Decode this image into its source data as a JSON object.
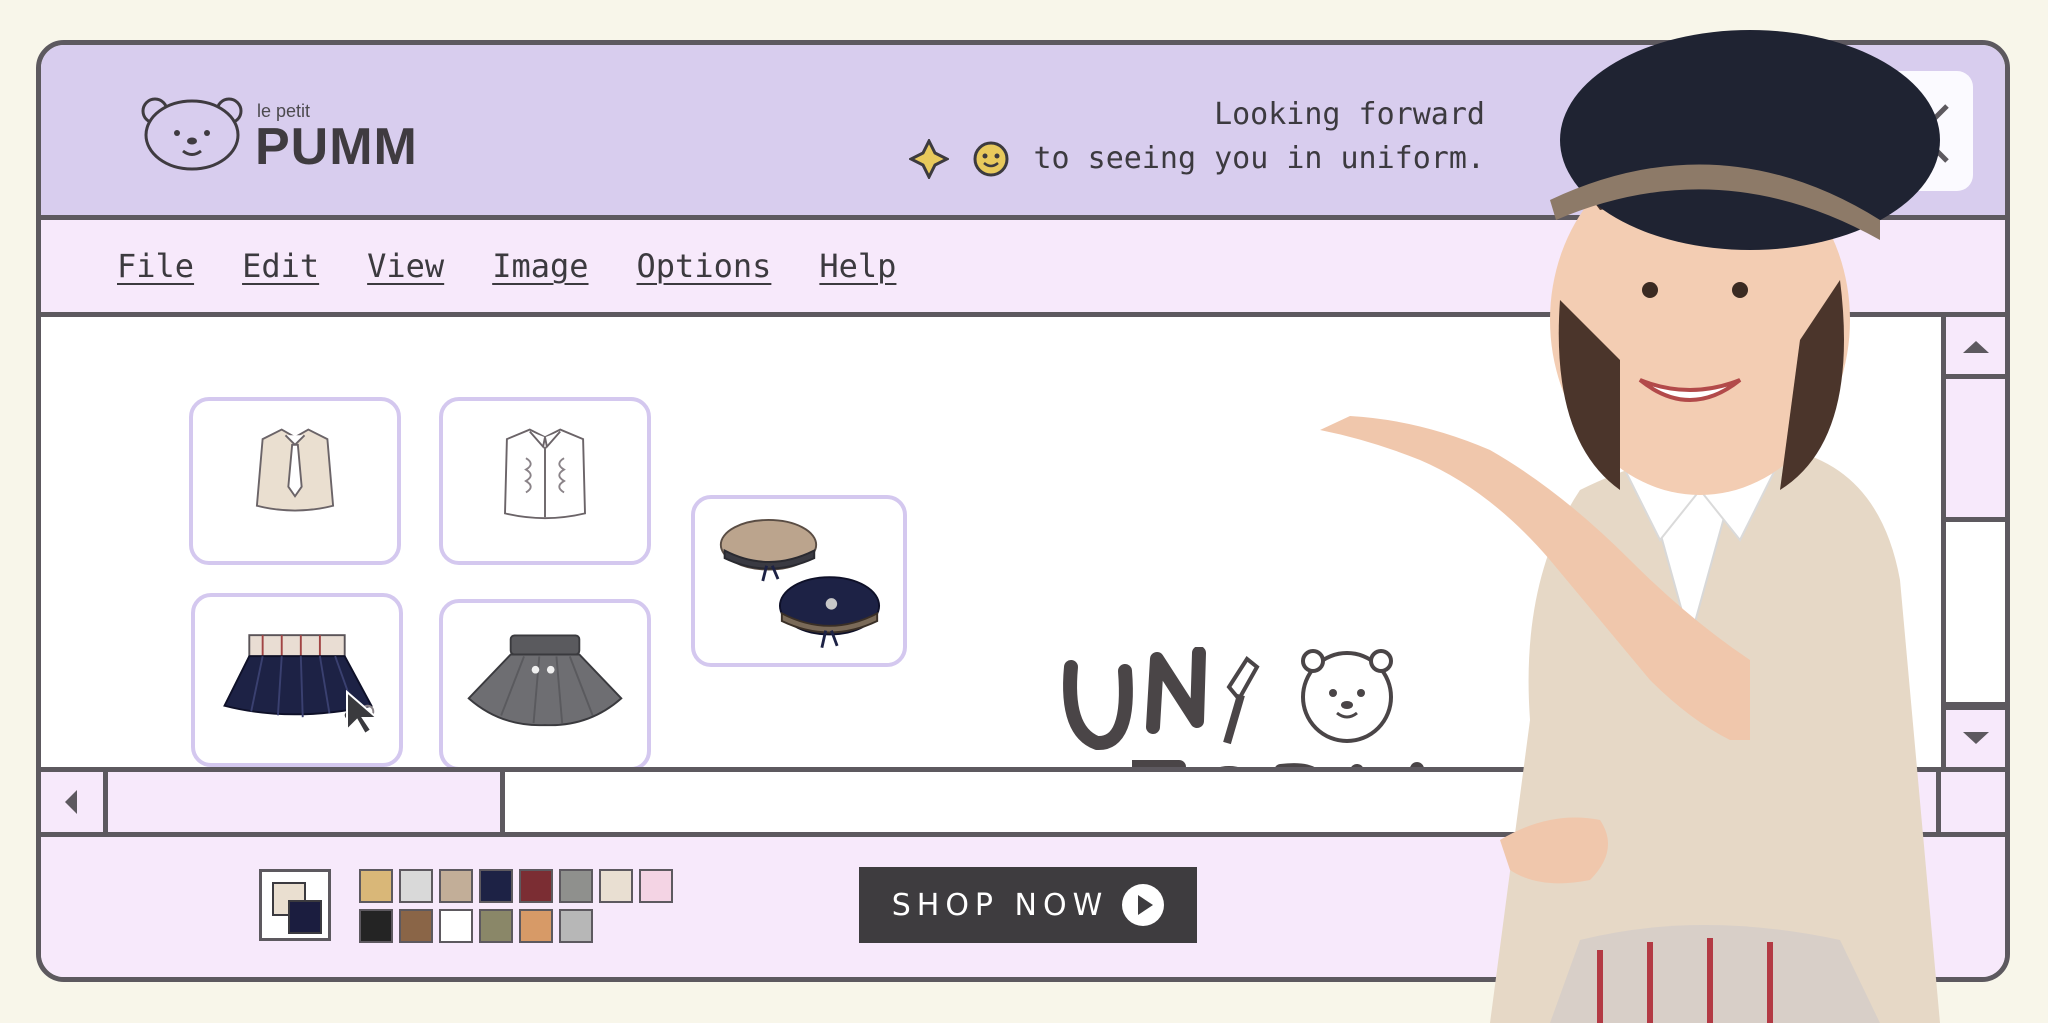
{
  "brand": {
    "small": "le petit",
    "name": "PUMM"
  },
  "tagline": {
    "line1": "Looking forward",
    "line2": "to seeing you in uniform."
  },
  "menu": [
    {
      "label": "File"
    },
    {
      "label": "Edit"
    },
    {
      "label": "View"
    },
    {
      "label": "Image"
    },
    {
      "label": "Options"
    },
    {
      "label": "Help"
    }
  ],
  "palette": [
    "#d9b778",
    "#d9d9d9",
    "#c2ae98",
    "#1d2245",
    "#7b2d33",
    "#8f908d",
    "#e9dfd2",
    "#f4d4e4",
    "#242424",
    "#8a6547",
    "#ffffff",
    "#8a8768",
    "#d79a67",
    "#b7b7b7"
  ],
  "selected_colors": {
    "foreground": "#1b1d3f",
    "background": "#eadfd0"
  },
  "cta": {
    "label": "SHOP NOW"
  },
  "art_text": {
    "line1": "UNI",
    "line2": "FORM"
  },
  "items": [
    {
      "name": "beige sleeveless blouse with tie"
    },
    {
      "name": "white ruffle sleeveless blouse"
    },
    {
      "name": "navy pleated skirt with check band"
    },
    {
      "name": "grey flared skirt"
    },
    {
      "name": "berets"
    }
  ],
  "colors": {
    "accent": "#d8cdee",
    "menu_bg": "#f7e9fb",
    "border": "#5d595f"
  }
}
